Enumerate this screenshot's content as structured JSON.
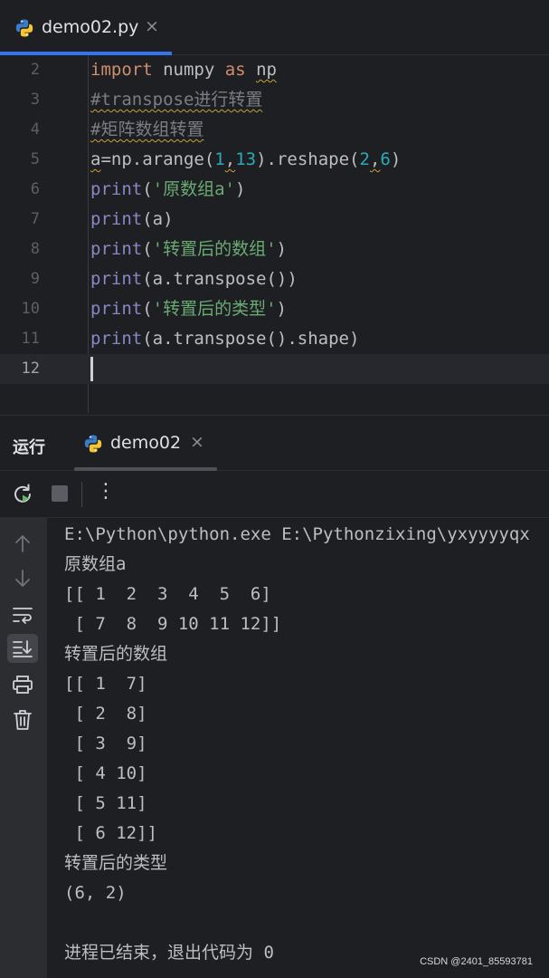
{
  "editor_tab": {
    "title": "demo02.py",
    "close_glyph": "×"
  },
  "code_lines": [
    {
      "num": "2",
      "tokens": [
        {
          "t": "import",
          "c": "kw"
        },
        {
          "t": " numpy ",
          "c": "plain"
        },
        {
          "t": "as",
          "c": "kw"
        },
        {
          "t": " ",
          "c": "plain"
        },
        {
          "t": "np",
          "c": "plain squig"
        }
      ]
    },
    {
      "num": "3",
      "tokens": [
        {
          "t": "#transpose进行转置",
          "c": "cmt squig"
        }
      ]
    },
    {
      "num": "4",
      "tokens": [
        {
          "t": "#矩阵数组转置",
          "c": "cmt squig"
        }
      ]
    },
    {
      "num": "5",
      "tokens": [
        {
          "t": "a",
          "c": "plain squig"
        },
        {
          "t": "=np.arange(",
          "c": "plain"
        },
        {
          "t": "1",
          "c": "numlit"
        },
        {
          "t": ",",
          "c": "plain squig"
        },
        {
          "t": "13",
          "c": "numlit"
        },
        {
          "t": ").reshape(",
          "c": "plain"
        },
        {
          "t": "2",
          "c": "numlit"
        },
        {
          "t": ",",
          "c": "plain squig"
        },
        {
          "t": "6",
          "c": "numlit"
        },
        {
          "t": ")",
          "c": "plain"
        }
      ]
    },
    {
      "num": "6",
      "tokens": [
        {
          "t": "print",
          "c": "fn"
        },
        {
          "t": "(",
          "c": "plain"
        },
        {
          "t": "'原数组a'",
          "c": "str"
        },
        {
          "t": ")",
          "c": "plain"
        }
      ]
    },
    {
      "num": "7",
      "tokens": [
        {
          "t": "print",
          "c": "fn"
        },
        {
          "t": "(a)",
          "c": "plain"
        }
      ]
    },
    {
      "num": "8",
      "tokens": [
        {
          "t": "print",
          "c": "fn"
        },
        {
          "t": "(",
          "c": "plain"
        },
        {
          "t": "'转置后的数组'",
          "c": "str"
        },
        {
          "t": ")",
          "c": "plain"
        }
      ]
    },
    {
      "num": "9",
      "tokens": [
        {
          "t": "print",
          "c": "fn"
        },
        {
          "t": "(a.transpose())",
          "c": "plain"
        }
      ]
    },
    {
      "num": "10",
      "tokens": [
        {
          "t": "print",
          "c": "fn"
        },
        {
          "t": "(",
          "c": "plain"
        },
        {
          "t": "'转置后的类型'",
          "c": "str"
        },
        {
          "t": ")",
          "c": "plain"
        }
      ]
    },
    {
      "num": "11",
      "tokens": [
        {
          "t": "print",
          "c": "fn"
        },
        {
          "t": "(a.transpose().shape)",
          "c": "plain"
        }
      ]
    },
    {
      "num": "12",
      "tokens": [],
      "current": true
    }
  ],
  "run_panel": {
    "label": "运行",
    "tab_title": "demo02",
    "close_glyph": "×",
    "toolbar": {
      "rerun_icon": "rerun-icon",
      "stop_icon": "stop-icon",
      "more_glyph": "⋮"
    },
    "side_icons": [
      "arrow-up-icon",
      "arrow-down-icon",
      "soft-wrap-icon",
      "scroll-to-end-icon",
      "print-icon",
      "trash-icon"
    ]
  },
  "console_lines": [
    "E:\\Python\\python.exe E:\\Pythonzixing\\yxyyyyqx",
    "原数组a",
    "[[ 1  2  3  4  5  6]",
    " [ 7  8  9 10 11 12]]",
    "转置后的数组",
    "[[ 1  7]",
    " [ 2  8]",
    " [ 3  9]",
    " [ 4 10]",
    " [ 5 11]",
    " [ 6 12]]",
    "转置后的类型",
    "(6, 2)",
    "",
    "进程已结束，退出代码为 0"
  ],
  "watermark": "CSDN @2401_85593781",
  "colors": {
    "accent": "#3574f0",
    "keyword": "#cf8e6d",
    "builtin": "#8888c6",
    "string": "#6aab73",
    "number": "#2aacb8",
    "comment": "#7a7e85"
  }
}
